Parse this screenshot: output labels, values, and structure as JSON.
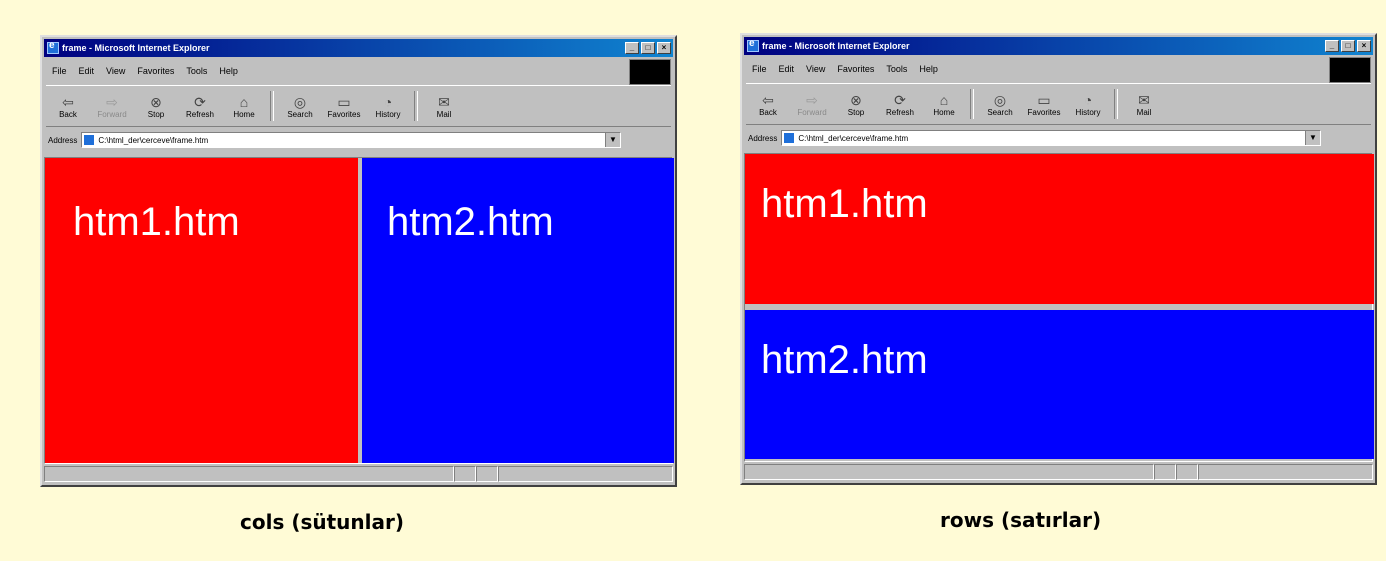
{
  "browser": {
    "title": "frame - Microsoft Internet Explorer",
    "menu": [
      "File",
      "Edit",
      "View",
      "Favorites",
      "Tools",
      "Help"
    ],
    "toolbar": [
      "Back",
      "Forward",
      "Stop",
      "Refresh",
      "Home",
      "Search",
      "Favorites",
      "History",
      "Mail"
    ],
    "address_label": "Address",
    "address_value": "C:\\html_der\\cerceve\\frame.htm"
  },
  "cols_window": {
    "frame1_label": "htm1.htm",
    "frame2_label": "htm2.htm",
    "caption": "cols (sütunlar)"
  },
  "rows_window": {
    "frame1_label": "htm1.htm",
    "frame2_label": "htm2.htm",
    "caption": "rows (satırlar)"
  },
  "colors": {
    "frame1": "#ff0000",
    "frame2": "#0000ff",
    "background": "#fffbd6"
  }
}
